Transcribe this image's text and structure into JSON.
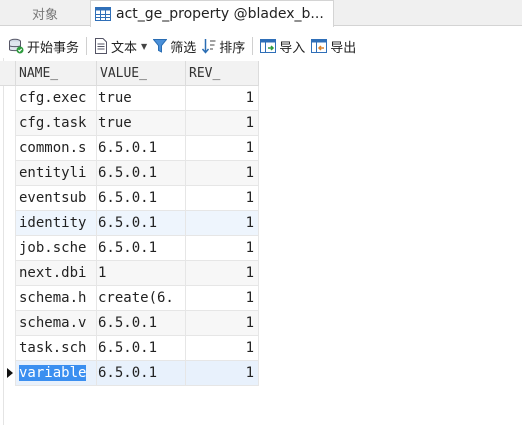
{
  "tabs": {
    "objects_label": "对象",
    "active_label": "act_ge_property @bladex_b..."
  },
  "toolbar": {
    "begin_transaction": "开始事务",
    "text": "文本",
    "filter": "筛选",
    "sort": "排序",
    "import": "导入",
    "export": "导出"
  },
  "grid": {
    "columns": [
      "NAME_",
      "VALUE_",
      "REV_"
    ],
    "rows": [
      {
        "name": "cfg.exec",
        "value": "true",
        "rev": "1"
      },
      {
        "name": "cfg.task",
        "value": "true",
        "rev": "1"
      },
      {
        "name": "common.s",
        "value": "6.5.0.1",
        "rev": "1"
      },
      {
        "name": "entityli",
        "value": "6.5.0.1",
        "rev": "1"
      },
      {
        "name": "eventsub",
        "value": "6.5.0.1",
        "rev": "1"
      },
      {
        "name": "identity",
        "value": "6.5.0.1",
        "rev": "1"
      },
      {
        "name": "job.sche",
        "value": "6.5.0.1",
        "rev": "1"
      },
      {
        "name": "next.dbi",
        "value": "1",
        "rev": "1"
      },
      {
        "name": "schema.h",
        "value": "create(6.",
        "rev": "1"
      },
      {
        "name": "schema.v",
        "value": "6.5.0.1",
        "rev": "1"
      },
      {
        "name": "task.sch",
        "value": "6.5.0.1",
        "rev": "1"
      },
      {
        "name": "variable",
        "value": "6.5.0.1",
        "rev": "1"
      }
    ]
  },
  "colors": {
    "selection": "#3b8ff0",
    "row_highlight": "#eef5fd"
  }
}
